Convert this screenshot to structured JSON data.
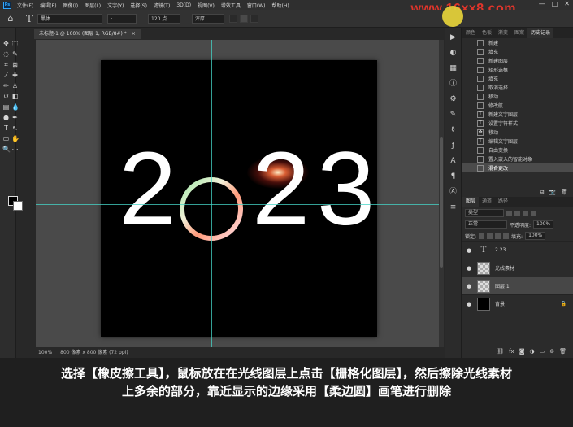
{
  "app": {
    "logo": "Ps"
  },
  "menu": [
    "文件(F)",
    "编辑(E)",
    "图像(I)",
    "图层(L)",
    "文字(Y)",
    "选择(S)",
    "滤镜(T)",
    "3D(D)",
    "视图(V)",
    "增效工具",
    "窗口(W)",
    "帮助(H)"
  ],
  "watermark": "www.16xx8.com",
  "window_controls": [
    "—",
    "□",
    "✕"
  ],
  "options": {
    "font_family": "黑体",
    "font_style": "-",
    "font_size": "120 点",
    "aa": "浑厚"
  },
  "document": {
    "tab_title": "未标题-1 @ 100% (图层 1, RGB/8#) *",
    "close": "×",
    "art_digits": [
      "2",
      "2",
      "3"
    ],
    "status_zoom": "100%",
    "status_info": "800 像素 x 800 像素 (72 ppi)"
  },
  "history": {
    "tabs": [
      "颜色",
      "色板",
      "渐变",
      "图案",
      "历史记录"
    ],
    "items": [
      {
        "icon": "doc-icon",
        "label": "新建"
      },
      {
        "icon": "fill-icon",
        "label": "填充"
      },
      {
        "icon": "layer-icon",
        "label": "新建图层"
      },
      {
        "icon": "marquee-icon",
        "label": "矩形选框"
      },
      {
        "icon": "fill-icon",
        "label": "填充"
      },
      {
        "icon": "doc-icon",
        "label": "取消选择"
      },
      {
        "icon": "layer-icon",
        "label": "移动"
      },
      {
        "icon": "layer-icon",
        "label": "修改航"
      },
      {
        "icon": "text-icon",
        "label": "新建文字图层"
      },
      {
        "icon": "text-icon",
        "label": "设置字符样式"
      },
      {
        "icon": "move-icon",
        "label": "移动"
      },
      {
        "icon": "text-icon",
        "label": "编辑文字图层"
      },
      {
        "icon": "layer-icon",
        "label": "自由变换"
      },
      {
        "icon": "layer-icon",
        "label": "置入嵌入的智能对象"
      },
      {
        "icon": "layer-icon",
        "label": "混合更改"
      }
    ],
    "selected_index": 14
  },
  "layers": {
    "tabs": [
      "图层",
      "通道",
      "路径"
    ],
    "kind": "类型",
    "blend": "正常",
    "opacity_label": "不透明度:",
    "opacity": "100%",
    "lock_label": "锁定:",
    "fill_label": "填充:",
    "fill": "100%",
    "items": [
      {
        "name": "2 23",
        "thumb": "text"
      },
      {
        "name": "光线素材",
        "thumb": "check"
      },
      {
        "name": "图层 1",
        "thumb": "check"
      },
      {
        "name": "背景",
        "thumb": "black"
      }
    ],
    "selected_index": 2,
    "text_thumb_glyph": "T",
    "lock_glyph": "🔒"
  },
  "subtitle": {
    "line1": "选择【橡皮擦工具】，鼠标放在在光线图层上点击【栅格化图层】，然后擦除光线素材",
    "line2": "上多余的部分，靠近显示的边缘采用【柔边圆】画笔进行删除"
  }
}
